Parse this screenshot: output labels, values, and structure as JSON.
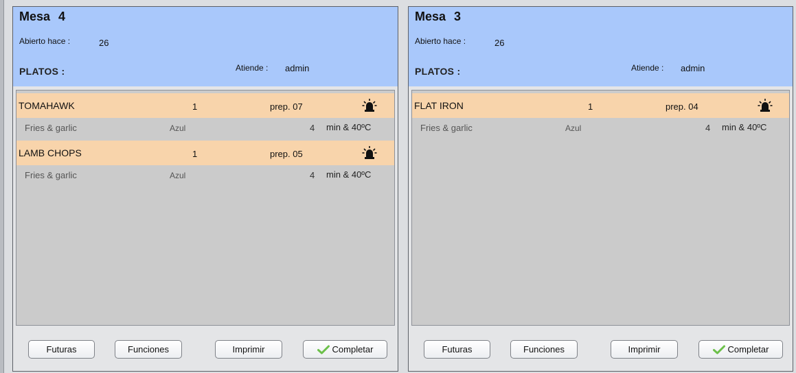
{
  "panels": [
    {
      "mesa_label": "Mesa",
      "mesa_number": "4",
      "abierto_label": "Abierto hace :",
      "abierto_value": "26",
      "platos_label": "PLATOS :",
      "atiende_label": "Atiende :",
      "atiende_value": "admin",
      "items": [
        {
          "name": "TOMAHAWK",
          "qty": "1",
          "prep": "prep. 07",
          "side": "Fries & garlic",
          "cook": "Azul",
          "minutes": "4",
          "temp": "min & 40ºC",
          "alarm_icon": "alarm-bell-icon"
        },
        {
          "name": "LAMB CHOPS",
          "qty": "1",
          "prep": "prep. 05",
          "side": "Fries & garlic",
          "cook": "Azul",
          "minutes": "4",
          "temp": "min & 40ºC",
          "alarm_icon": "alarm-bell-icon"
        }
      ],
      "buttons": {
        "futuras": "Futuras",
        "funciones": "Funciones",
        "imprimir": "Imprimir",
        "completar": "Completar"
      }
    },
    {
      "mesa_label": "Mesa",
      "mesa_number": "3",
      "abierto_label": "Abierto hace :",
      "abierto_value": "26",
      "platos_label": "PLATOS :",
      "atiende_label": "Atiende :",
      "atiende_value": "admin",
      "items": [
        {
          "name": "FLAT IRON",
          "qty": "1",
          "prep": "prep. 04",
          "side": "Fries & garlic",
          "cook": "Azul",
          "minutes": "4",
          "temp": "min & 40ºC",
          "alarm_icon": "alarm-bell-icon"
        }
      ],
      "buttons": {
        "futuras": "Futuras",
        "funciones": "Funciones",
        "imprimir": "Imprimir",
        "completar": "Completar"
      }
    }
  ],
  "colors": {
    "header_bg": "#a9c8fb",
    "dish_row_bg": "#f8d4ab",
    "list_bg": "#cbcbcb",
    "check_green": "#6cc04a"
  }
}
